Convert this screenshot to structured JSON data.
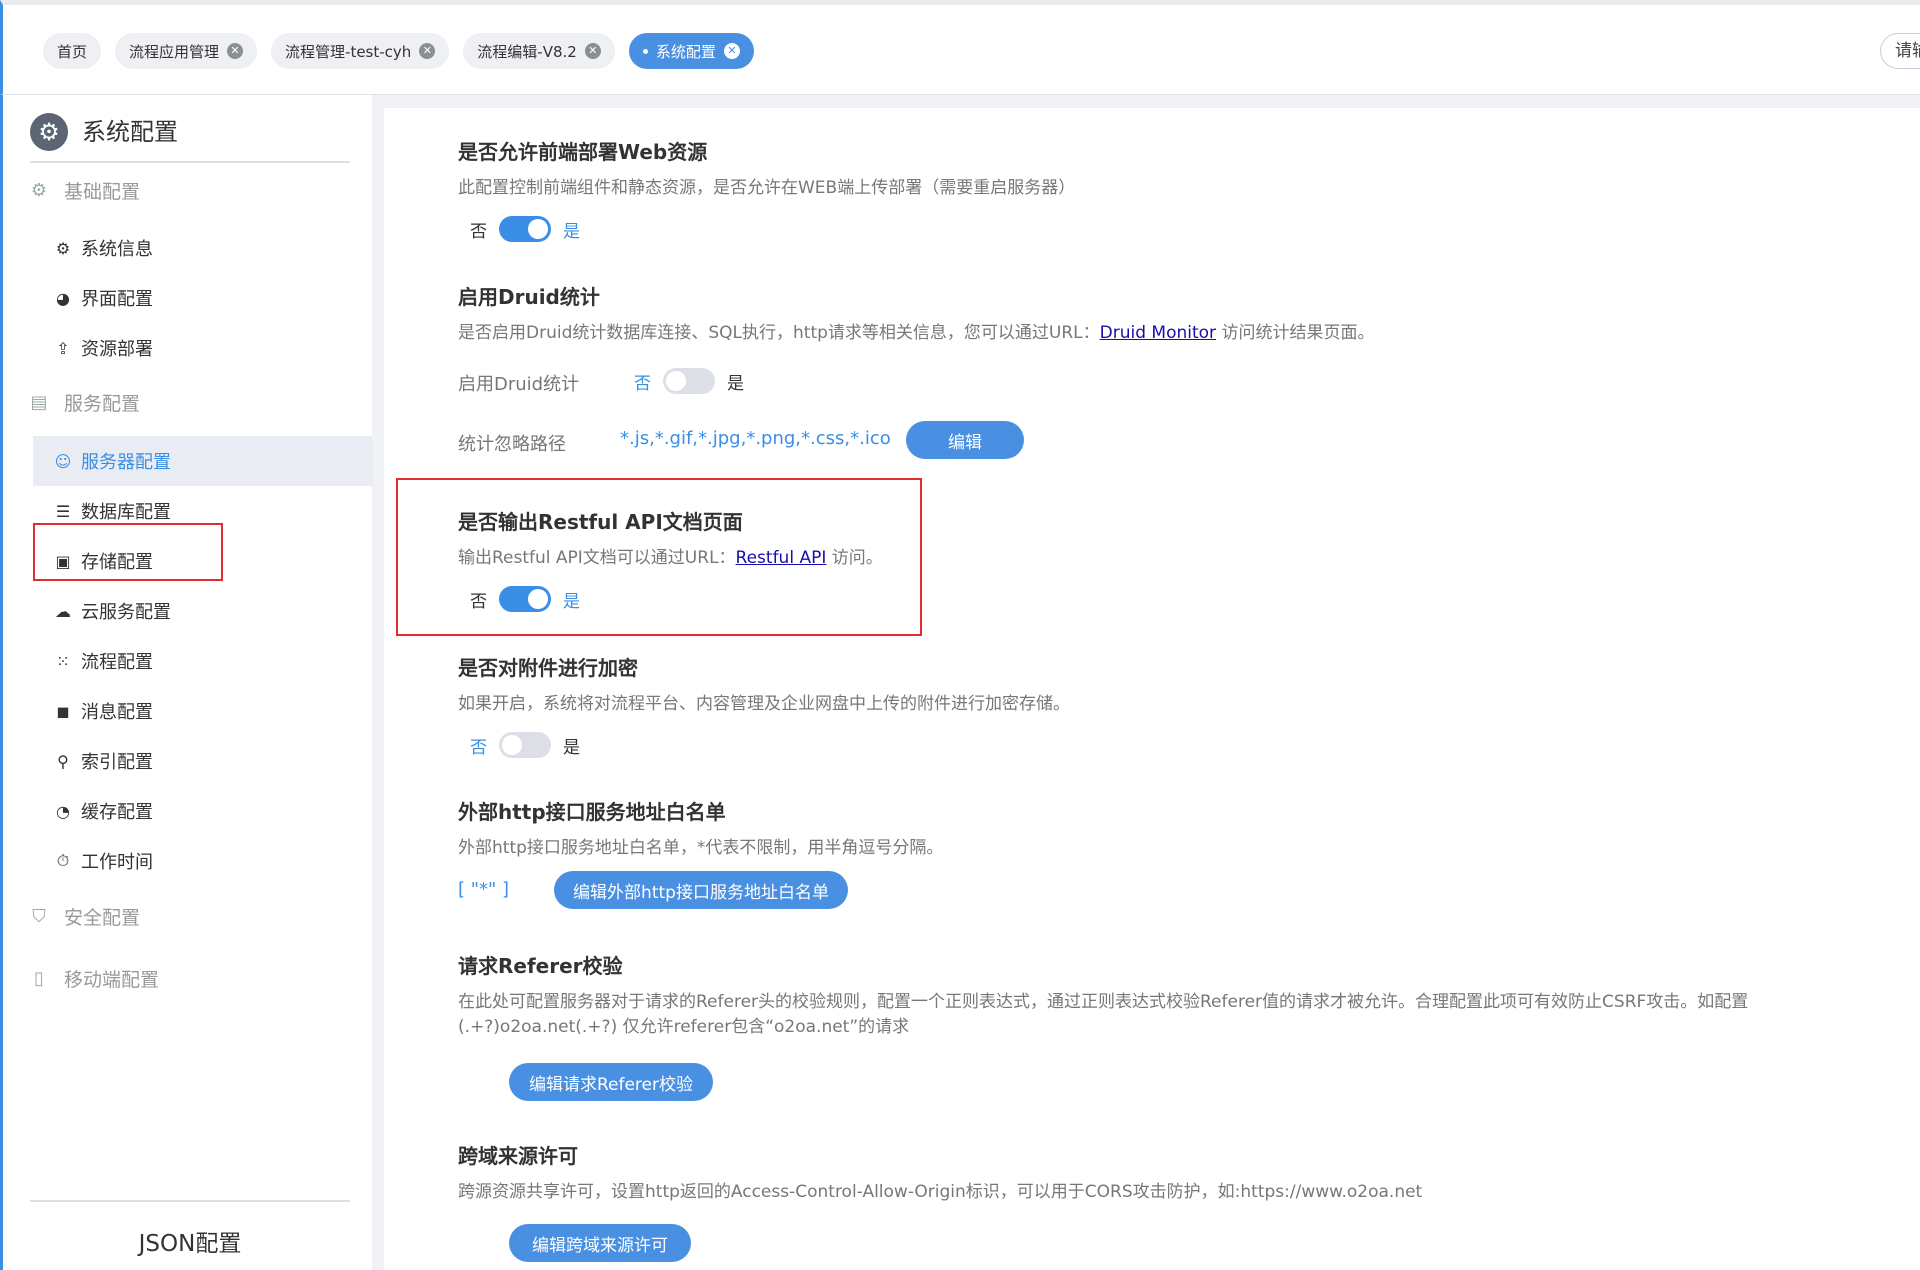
{
  "tabs": [
    {
      "label": "首页",
      "closable": false
    },
    {
      "label": "流程应用管理",
      "closable": true
    },
    {
      "label": "流程管理-test-cyh",
      "closable": true
    },
    {
      "label": "流程编辑-V8.2",
      "closable": true
    },
    {
      "label": "系统配置",
      "closable": true,
      "active": true
    }
  ],
  "top_search": {
    "placeholder": "请输"
  },
  "sidebar": {
    "title": "系统配置",
    "groups": {
      "basic": "基础配置",
      "service": "服务配置",
      "security": "安全配置",
      "mobile": "移动端配置"
    },
    "items": {
      "system_info": "系统信息",
      "ui_config": "界面配置",
      "resource_deploy": "资源部署",
      "server_config": "服务器配置",
      "database_config": "数据库配置",
      "storage_config": "存储配置",
      "cloud_config": "云服务配置",
      "process_config": "流程配置",
      "message_config": "消息配置",
      "index_config": "索引配置",
      "cache_config": "缓存配置",
      "work_time": "工作时间"
    },
    "footer": "JSON配置"
  },
  "main": {
    "web_resource": {
      "title": "是否允许前端部署Web资源",
      "desc": "此配置控制前端组件和静态资源，是否允许在WEB端上传部署（需要重启服务器）",
      "off_label": "否",
      "on_label": "是",
      "enabled": true
    },
    "druid": {
      "title": "启用Druid统计",
      "desc_before": "是否启用Druid统计数据库连接、SQL执行，http请求等相关信息，您可以通过URL：",
      "link": "Druid Monitor",
      "desc_after": " 访问统计结果页面。",
      "switch_label": "启用Druid统计",
      "off_label": "否",
      "on_label": "是",
      "enabled": false,
      "ignore_label": "统计忽略路径",
      "ignore_value": "*.js,*.gif,*.jpg,*.png,*.css,*.ico",
      "edit_button": "编辑"
    },
    "restful": {
      "title": "是否输出Restful API文档页面",
      "desc_before": "输出Restful API文档可以通过URL：",
      "link": "Restful API",
      "desc_after": " 访问。",
      "off_label": "否",
      "on_label": "是",
      "enabled": true
    },
    "encrypt": {
      "title": "是否对附件进行加密",
      "desc": "如果开启，系统将对流程平台、内容管理及企业网盘中上传的附件进行加密存储。",
      "off_label": "否",
      "on_label": "是",
      "enabled": false
    },
    "whitelist": {
      "title": "外部http接口服务地址白名单",
      "desc": "外部http接口服务地址白名单，*代表不限制，用半角逗号分隔。",
      "value": "[ \"*\" ]",
      "edit_button": "编辑外部http接口服务地址白名单"
    },
    "referer": {
      "title": "请求Referer校验",
      "desc_line1": "在此处可配置服务器对于请求的Referer头的校验规则，配置一个正则表达式，通过正则表达式校验Referer值的请求才被允许。合理配置此项可有效防止CSRF攻击。如配置",
      "desc_line2": "(.+?)o2oa.net(.+?) 仅允许referer包含“o2oa.net”的请求",
      "edit_button": "编辑请求Referer校验"
    },
    "cors": {
      "title": "跨域来源许可",
      "desc": "跨源资源共享许可，设置http返回的Access-Control-Allow-Origin标识，可以用于CORS攻击防护，如:https://www.o2oa.net",
      "edit_button": "编辑跨域来源许可"
    }
  }
}
